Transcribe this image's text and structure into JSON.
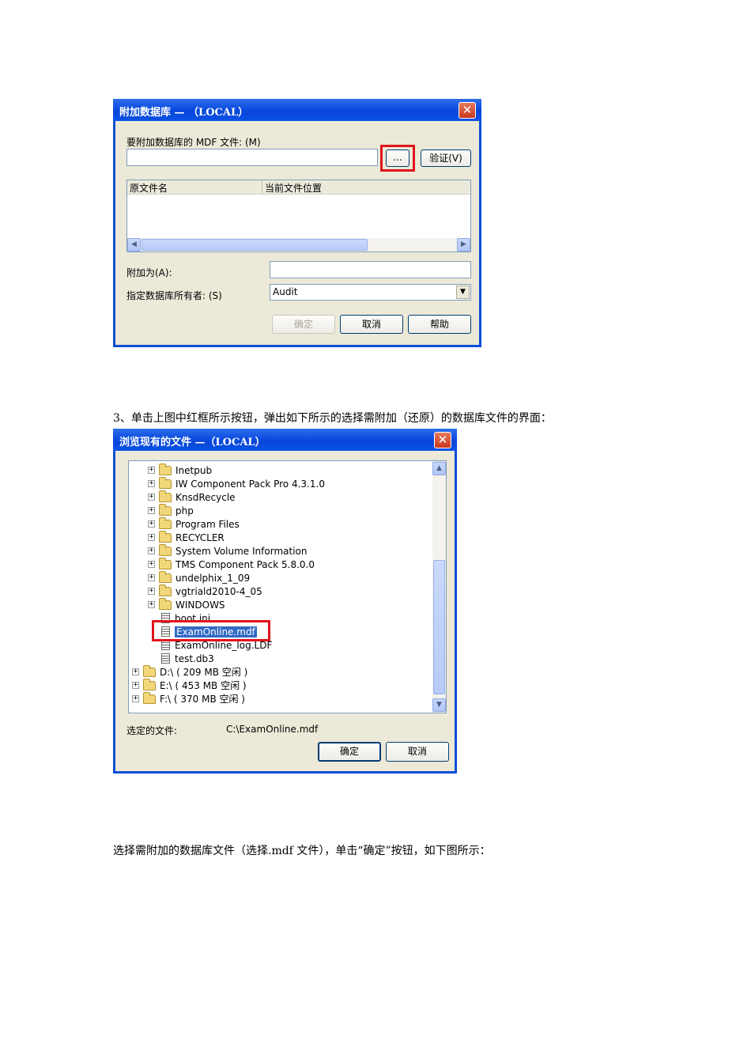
{
  "attach_dialog": {
    "title": "附加数据库 — （LOCAL）",
    "mdf_label": "要附加数据库的 MDF 文件:  (M)",
    "browse_label": "...",
    "verify_label": "验证(V)",
    "columns": [
      "原文件名",
      "当前文件位置"
    ],
    "attach_as_label": "附加为(A):",
    "attach_as_value": "",
    "owner_label": "指定数据库所有者: (S)",
    "owner_value": "Audit",
    "ok_label": "确定",
    "cancel_label": "取消",
    "help_label": "帮助"
  },
  "step3_text": "3、单击上图中红框所示按钮，弹出如下所示的选择需附加（还原）的数据库文件的界面：",
  "browse_dialog": {
    "title": "浏览现有的文件 —（LOCAL）",
    "folders": [
      "Inetpub",
      "IW Component Pack Pro 4.3.1.0",
      "KnsdRecycle",
      "php",
      "Program Files",
      "RECYCLER",
      "System Volume Information",
      "TMS Component Pack 5.8.0.0",
      "undelphix_1_09",
      "vgtriald2010-4_05",
      "WINDOWS"
    ],
    "files": [
      "boot.ini",
      "ExamOnline.mdf",
      "ExamOnline_log.LDF",
      "test.db3"
    ],
    "selected_file": "ExamOnline.mdf",
    "drives": [
      "D:\\ ( 209 MB 空闲 )",
      "E:\\ ( 453 MB 空闲 )",
      "F:\\ ( 370 MB 空闲 )"
    ],
    "selected_label": "选定的文件:",
    "selected_path": "C:\\ExamOnline.mdf",
    "ok_label": "确定",
    "cancel_label": "取消"
  },
  "final_text": "选择需附加的数据库文件（选择.mdf 文件），单击“确定”按钮，如下图所示："
}
